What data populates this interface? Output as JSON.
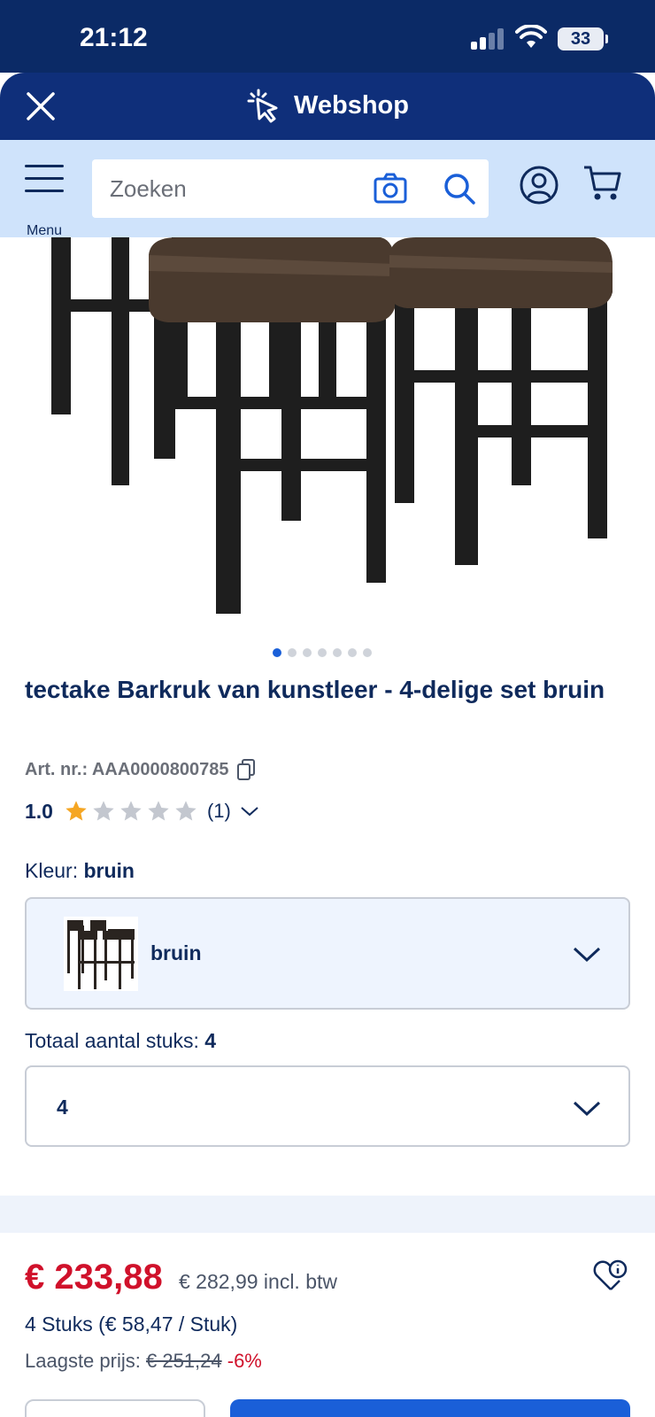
{
  "status_bar": {
    "time": "21:12",
    "battery": "33"
  },
  "header": {
    "title": "Webshop"
  },
  "search": {
    "menu_label": "Menu",
    "placeholder": "Zoeken"
  },
  "product": {
    "title": "tectake Barkruk van kunstleer - 4-delige set bruin",
    "article_number": "Art. nr.: AAA0000800785",
    "rating_value": "1.0",
    "rating_stars": 1,
    "rating_max": 5,
    "rating_count": "(1)",
    "image_count": 7,
    "active_image": 1
  },
  "color": {
    "label": "Kleur:",
    "selected": "bruin",
    "option_name": "bruin"
  },
  "quantity": {
    "label": "Totaal aantal stuks:",
    "total": "4",
    "selected": "4"
  },
  "price": {
    "current": "€ 233,88",
    "original": "€ 282,99 incl. btw",
    "per_unit": "4 Stuks (€ 58,47 / Stuk)",
    "lowest_label": "Laagste prijs:",
    "lowest_value": "€ 251,24",
    "discount": "-6%"
  },
  "colors": {
    "brand_dark": "#0b2a66",
    "accent_blue": "#1a5fd8",
    "price_red": "#d0112b",
    "star": "#f5a623"
  }
}
